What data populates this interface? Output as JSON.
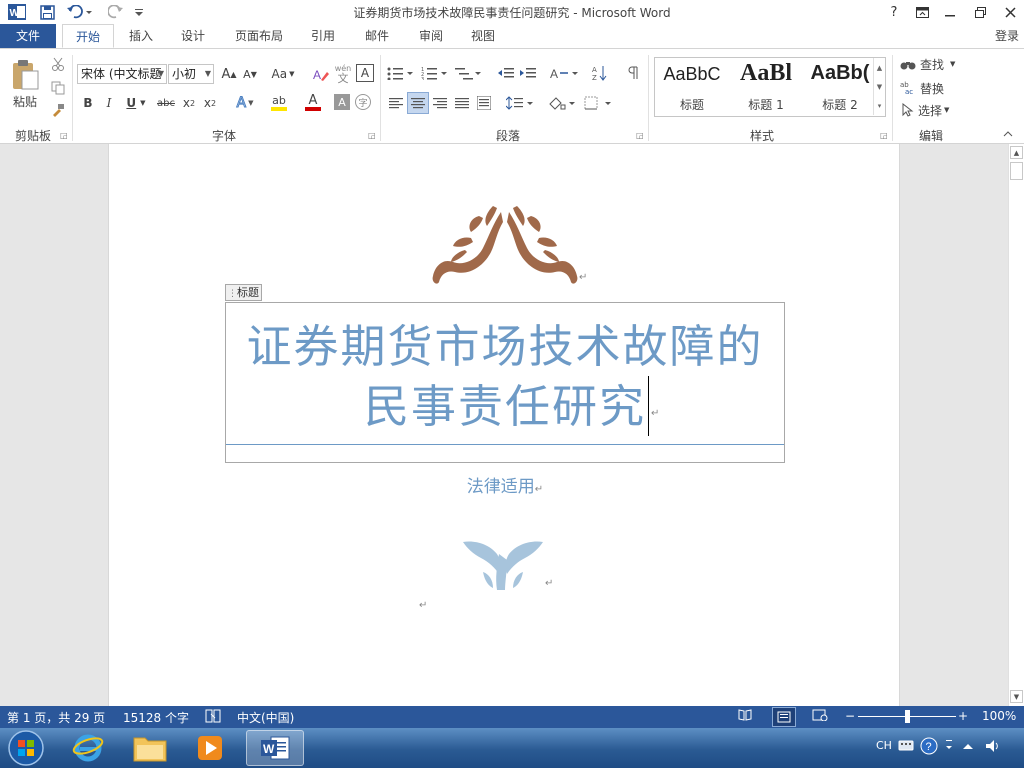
{
  "window": {
    "title": "证券期货市场技术故障民事责任问题研究 - Microsoft Word",
    "help": "?",
    "login": "登录"
  },
  "tabs": [
    "文件",
    "开始",
    "插入",
    "设计",
    "页面布局",
    "引用",
    "邮件",
    "审阅",
    "视图"
  ],
  "ribbon": {
    "clipboard": {
      "label": "剪贴板",
      "paste": "粘贴"
    },
    "font": {
      "label": "字体",
      "name": "宋体 (中文标题",
      "size": "小初",
      "grow": "A",
      "shrink": "A",
      "case": "Aa",
      "phonetic_top": "wén",
      "phonetic_bottom": "文",
      "border_char": "A",
      "bold": "B",
      "italic": "I",
      "underline": "U",
      "strike": "abc",
      "subscript": "x",
      "subscript_mark": "2",
      "superscript": "x",
      "superscript_mark": "2",
      "effects": "A",
      "highlight": "ab",
      "color": "A",
      "shading": "A",
      "enclose": "字"
    },
    "paragraph": {
      "label": "段落"
    },
    "styles": {
      "label": "样式",
      "items": [
        {
          "preview": "AaBbC",
          "name": "标题"
        },
        {
          "preview": "AaBl",
          "name": "标题 1"
        },
        {
          "preview": "AaBb(",
          "name": "标题 2"
        }
      ]
    },
    "editing": {
      "label": "编辑",
      "find": "查找",
      "replace": "替换",
      "select": "选择"
    }
  },
  "document": {
    "title_tag": "标题",
    "title_line1": "证券期货市场技术故障的",
    "title_line2": "民事责任研究",
    "subtitle": "法律适用",
    "paragraph_mark": "↵"
  },
  "status": {
    "page": "第 1 页，共 29 页",
    "words": "15128 个字",
    "language": "中文(中国)",
    "zoom": "100%",
    "zoom_level_percent": 100
  },
  "taskbar": {
    "tray_lang": "CH",
    "apps": [
      "start-orb",
      "internet-explorer",
      "file-explorer",
      "media-player",
      "word"
    ]
  },
  "colors": {
    "accent": "#2b579a",
    "title_blue": "#6d9ac6",
    "ornament_brown": "#a0694a",
    "ornament_blue": "#a7c4dc"
  }
}
